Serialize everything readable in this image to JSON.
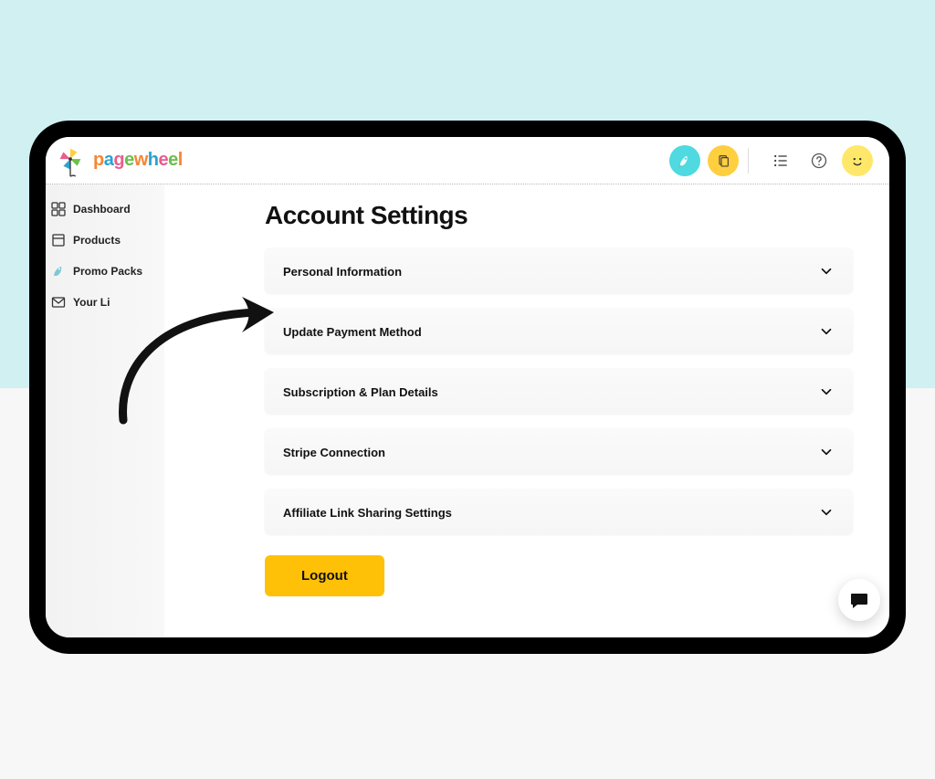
{
  "brand": {
    "name": "pagewheel",
    "letters": [
      "p",
      "a",
      "g",
      "e",
      "w",
      "h",
      "e",
      "e",
      "l"
    ]
  },
  "topbar": {
    "rocket_icon": "rocket-icon",
    "copy_icon": "copy-icon",
    "list_icon": "list-icon",
    "help_icon": "help-icon",
    "smiley_icon": "smiley-icon"
  },
  "sidebar": {
    "items": [
      {
        "icon": "grid-icon",
        "label": "Dashboard"
      },
      {
        "icon": "box-icon",
        "label": "Products"
      },
      {
        "icon": "rocket-small-icon",
        "label": "Promo Packs"
      },
      {
        "icon": "mail-icon",
        "label": "Your Li"
      }
    ]
  },
  "page": {
    "title": "Account Settings"
  },
  "panels": [
    {
      "label": "Personal Information"
    },
    {
      "label": "Update Payment Method"
    },
    {
      "label": "Subscription & Plan Details"
    },
    {
      "label": "Stripe Connection"
    },
    {
      "label": "Affiliate Link Sharing Settings"
    }
  ],
  "actions": {
    "logout_label": "Logout"
  }
}
